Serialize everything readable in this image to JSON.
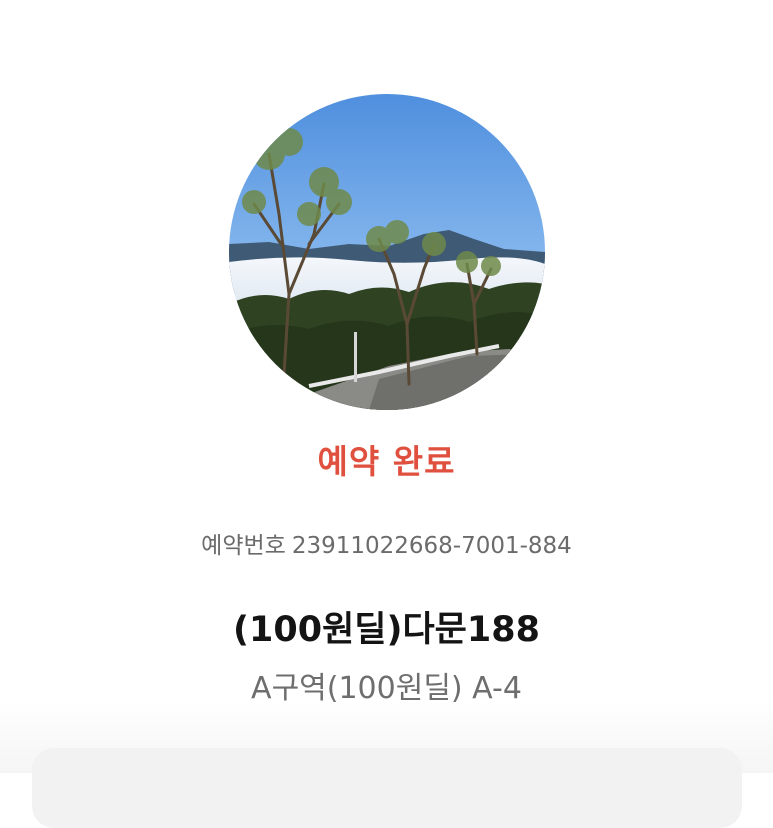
{
  "reservation": {
    "status": "예약 완료",
    "booking_label": "예약번호",
    "booking_number": "23911022668-7001-884",
    "product_name": "(100원딜)다문188",
    "zone": "A구역(100원딜) A-4"
  },
  "image": {
    "icon": "campsite-photo"
  },
  "colors": {
    "accent": "#e0503e",
    "secondary_text": "#6b6b6b",
    "primary_text": "#141414"
  }
}
